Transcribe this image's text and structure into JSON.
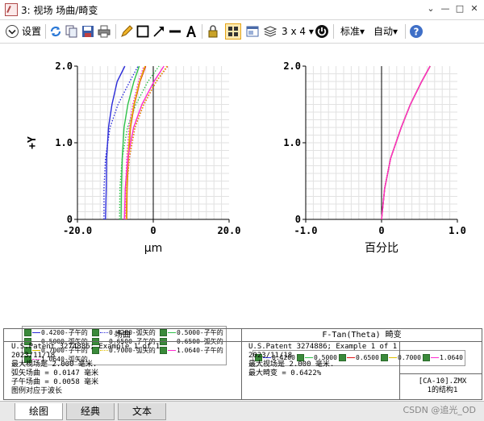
{
  "window": {
    "title": "3: 视场 场曲/畸变",
    "controls": [
      "⌄",
      "—",
      "□",
      "✕"
    ]
  },
  "toolbar": {
    "settings_label": "设置",
    "layout_label": "3 x 4",
    "standard_label": "标准",
    "auto_label": "自动"
  },
  "chart_data": [
    {
      "type": "line",
      "title": "场曲",
      "ylabel": "+Y",
      "xlabel": "μm",
      "xlim": [
        -20,
        20
      ],
      "ylim": [
        0,
        2
      ],
      "xticks": [
        "-20.0",
        "0",
        "20.0"
      ],
      "yticks": [
        "0",
        "1.0",
        "2.0"
      ],
      "grid": true,
      "series": [
        {
          "name": "0.4200-子午的",
          "color": "#2b2bd9",
          "style": "dotted",
          "points": [
            [
              -13.0,
              0
            ],
            [
              -13.0,
              0.4
            ],
            [
              -12.6,
              0.8
            ],
            [
              -11.4,
              1.2
            ],
            [
              -9.3,
              1.5
            ],
            [
              -6.2,
              1.8
            ],
            [
              -4.0,
              2.0
            ]
          ]
        },
        {
          "name": "0.4200-弧矢的",
          "color": "#2b2bd9",
          "style": "solid",
          "points": [
            [
              -12.6,
              0
            ],
            [
              -12.4,
              0.4
            ],
            [
              -12.3,
              0.8
            ],
            [
              -11.8,
              1.2
            ],
            [
              -10.9,
              1.5
            ],
            [
              -9.5,
              1.8
            ],
            [
              -7.5,
              2.0
            ]
          ]
        },
        {
          "name": "0.5000-子午的",
          "color": "#2fc24a",
          "style": "dotted",
          "points": [
            [
              -8.9,
              0
            ],
            [
              -8.8,
              0.4
            ],
            [
              -8.2,
              0.8
            ],
            [
              -6.8,
              1.2
            ],
            [
              -4.6,
              1.5
            ],
            [
              -1.4,
              1.8
            ],
            [
              1.5,
              2.0
            ]
          ]
        },
        {
          "name": "0.5000-弧矢的",
          "color": "#2fc24a",
          "style": "solid",
          "points": [
            [
              -8.5,
              0
            ],
            [
              -8.4,
              0.4
            ],
            [
              -8.2,
              0.8
            ],
            [
              -7.7,
              1.2
            ],
            [
              -6.7,
              1.5
            ],
            [
              -5.1,
              1.8
            ],
            [
              -3.7,
              2.0
            ]
          ]
        },
        {
          "name": "0.6500-子午的",
          "color": "#e01515",
          "style": "dotted",
          "points": [
            [
              -7.2,
              0
            ],
            [
              -7.0,
              0.4
            ],
            [
              -6.3,
              0.8
            ],
            [
              -4.8,
              1.2
            ],
            [
              -2.5,
              1.5
            ],
            [
              0.8,
              1.8
            ],
            [
              3.8,
              2.0
            ]
          ]
        },
        {
          "name": "0.6500-弧矢的",
          "color": "#e01515",
          "style": "solid",
          "points": [
            [
              -7.0,
              0
            ],
            [
              -6.9,
              0.4
            ],
            [
              -6.6,
              0.8
            ],
            [
              -6.0,
              1.2
            ],
            [
              -5.0,
              1.5
            ],
            [
              -3.5,
              1.8
            ],
            [
              -2.0,
              2.0
            ]
          ]
        },
        {
          "name": "0.7000-子午的",
          "color": "#e0c000",
          "style": "dotted",
          "points": [
            [
              -7.3,
              0
            ],
            [
              -7.1,
              0.4
            ],
            [
              -6.4,
              0.8
            ],
            [
              -4.9,
              1.2
            ],
            [
              -2.6,
              1.5
            ],
            [
              0.7,
              1.8
            ],
            [
              3.6,
              2.0
            ]
          ]
        },
        {
          "name": "0.7000-弧矢的",
          "color": "#e0c000",
          "style": "solid",
          "points": [
            [
              -7.1,
              0
            ],
            [
              -7.0,
              0.4
            ],
            [
              -6.7,
              0.8
            ],
            [
              -6.1,
              1.2
            ],
            [
              -5.1,
              1.5
            ],
            [
              -3.6,
              1.8
            ],
            [
              -2.2,
              2.0
            ]
          ]
        },
        {
          "name": "1.0640-子午的",
          "color": "#ff2ad0",
          "style": "solid",
          "points": [
            [
              -7.6,
              0
            ],
            [
              -7.4,
              0.4
            ],
            [
              -6.7,
              0.8
            ],
            [
              -5.2,
              1.2
            ],
            [
              -3.0,
              1.5
            ],
            [
              0.2,
              1.8
            ],
            [
              2.8,
              2.0
            ]
          ]
        },
        {
          "name": "1.0640-弧矢的",
          "color": "#ff2ad0",
          "style": "dotted",
          "points": [
            [
              -7.4,
              0
            ],
            [
              -7.3,
              0.4
            ],
            [
              -7.0,
              0.8
            ],
            [
              -6.4,
              1.2
            ],
            [
              -5.4,
              1.5
            ],
            [
              -3.9,
              1.8
            ],
            [
              -2.5,
              2.0
            ]
          ]
        }
      ]
    },
    {
      "type": "line",
      "title": "F-Tan(Theta) 畸变",
      "xlabel": "百分比",
      "xlim": [
        -1,
        1
      ],
      "ylim": [
        0,
        2
      ],
      "xticks": [
        "-1.0",
        "0",
        "1.0"
      ],
      "yticks": [
        "0",
        "1.0",
        "2.0"
      ],
      "grid": true,
      "series": [
        {
          "name": "0.4200",
          "color": "#2b2bd9",
          "points": [
            [
              0,
              0
            ],
            [
              0.04,
              0.4
            ],
            [
              0.12,
              0.8
            ],
            [
              0.26,
              1.2
            ],
            [
              0.38,
              1.5
            ],
            [
              0.53,
              1.8
            ],
            [
              0.64,
              2.0
            ]
          ]
        },
        {
          "name": "0.5000",
          "color": "#2fc24a",
          "points": [
            [
              0,
              0
            ],
            [
              0.04,
              0.4
            ],
            [
              0.12,
              0.8
            ],
            [
              0.26,
              1.2
            ],
            [
              0.38,
              1.5
            ],
            [
              0.53,
              1.8
            ],
            [
              0.64,
              2.0
            ]
          ]
        },
        {
          "name": "0.6500",
          "color": "#e01515",
          "points": [
            [
              0,
              0
            ],
            [
              0.04,
              0.4
            ],
            [
              0.12,
              0.8
            ],
            [
              0.26,
              1.2
            ],
            [
              0.38,
              1.5
            ],
            [
              0.53,
              1.8
            ],
            [
              0.64,
              2.0
            ]
          ]
        },
        {
          "name": "0.7000",
          "color": "#e0c000",
          "points": [
            [
              0,
              0
            ],
            [
              0.04,
              0.4
            ],
            [
              0.12,
              0.8
            ],
            [
              0.26,
              1.2
            ],
            [
              0.38,
              1.5
            ],
            [
              0.53,
              1.8
            ],
            [
              0.64,
              2.0
            ]
          ]
        },
        {
          "name": "1.0640",
          "color": "#ff2ad0",
          "points": [
            [
              0,
              0
            ],
            [
              0.04,
              0.4
            ],
            [
              0.12,
              0.8
            ],
            [
              0.26,
              1.2
            ],
            [
              0.38,
              1.5
            ],
            [
              0.53,
              1.8
            ],
            [
              0.64,
              2.0
            ]
          ]
        }
      ]
    }
  ],
  "legend_left": [
    {
      "label": "0.4200-子午的",
      "color": "#2b2bd9",
      "style": "solid"
    },
    {
      "label": "0.4200-弧矢的",
      "color": "#2b2bd9",
      "style": "dotted"
    },
    {
      "label": "0.5000-子午的",
      "color": "#2fc24a",
      "style": "solid"
    },
    {
      "label": "0.5000-弧矢的",
      "color": "#2fc24a",
      "style": "dotted"
    },
    {
      "label": "0.6500-子午的",
      "color": "#e01515",
      "style": "solid"
    },
    {
      "label": "0.6500-弧矢的",
      "color": "#e01515",
      "style": "dotted"
    },
    {
      "label": "0.7000-子午的",
      "color": "#e0c000",
      "style": "solid"
    },
    {
      "label": "0.7000-弧矢的",
      "color": "#e0c000",
      "style": "dotted"
    },
    {
      "label": "1.0640-子午的",
      "color": "#ff2ad0",
      "style": "solid"
    },
    {
      "label": "1.0640-弧矢的",
      "color": "#ff2ad0",
      "style": "dotted"
    }
  ],
  "legend_right": [
    {
      "label": "0.4200",
      "color": "#2b2bd9"
    },
    {
      "label": "0.5000",
      "color": "#2fc24a"
    },
    {
      "label": "0.6500",
      "color": "#e01515"
    },
    {
      "label": "0.7000",
      "color": "#e0c000"
    },
    {
      "label": "1.0640",
      "color": "#ff2ad0"
    }
  ],
  "info": {
    "left_header": "场曲",
    "left_lines": [
      "U.S.Patent 3274886; Example 1 of 1",
      "2023/11/18",
      "最大视场是 2.000 毫米.",
      "弧矢场曲 = 0.0147 毫米",
      "子午场曲 = 0.0058 毫米",
      "图例对应于波长"
    ],
    "right_header": "F-Tan(Theta) 畸变",
    "right_lines": [
      "U.S.Patent 3274886; Example 1 of 1",
      "2023/11/18",
      "最大视场是 2.000 毫米.",
      "最大畸变 = 0.6422%"
    ],
    "file_name": "[CA-10].ZMX",
    "config": "1的结构1"
  },
  "tabs": [
    "绘图",
    "经典",
    "文本"
  ],
  "watermark": "CSDN @追光_OD"
}
